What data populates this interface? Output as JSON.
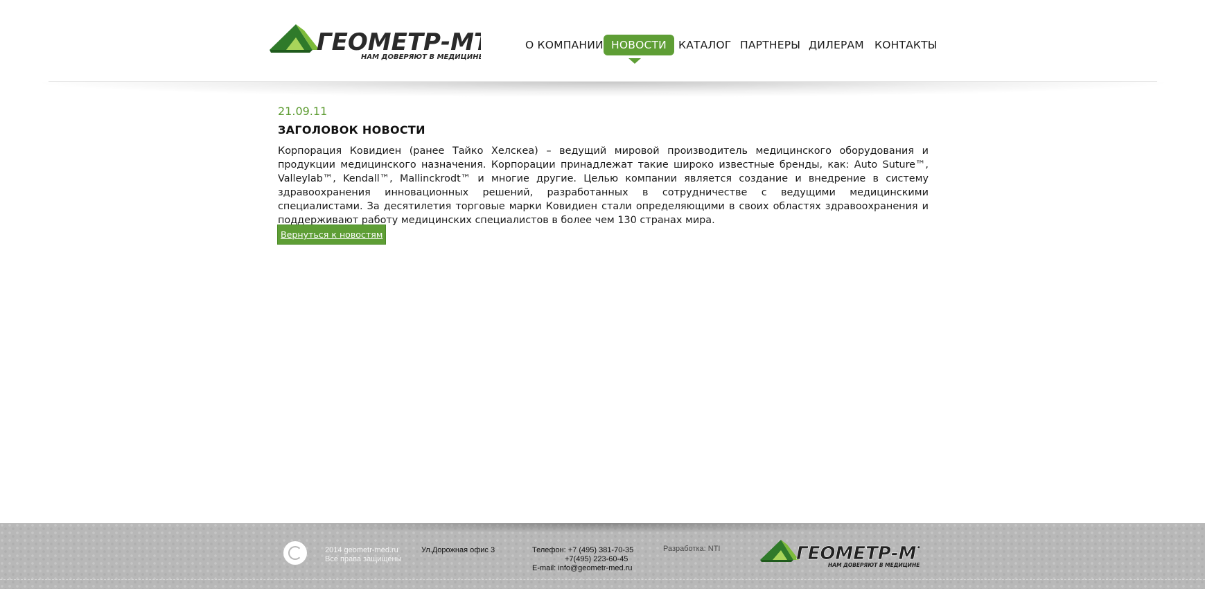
{
  "header": {
    "logo": {
      "name": "ГЕОМЕТР-МТ",
      "tagline": "НАМ ДОВЕРЯЮТ В МЕДИЦИНЕ"
    },
    "nav": [
      {
        "label": "О КОМПАНИИ",
        "active": false
      },
      {
        "label": "НОВОСТИ",
        "active": true
      },
      {
        "label": "КАТАЛОГ",
        "active": false
      },
      {
        "label": "ПАРТНЕРЫ",
        "active": false
      },
      {
        "label": "ДИЛЕРАМ",
        "active": false
      },
      {
        "label": "КОНТАКТЫ",
        "active": false
      }
    ]
  },
  "article": {
    "date": "21.09.11",
    "title": "ЗАГОЛОВОК НОВОСТИ",
    "body": "Корпорация Ковидиен (ранее Тайко Хелскеа) – ведущий мировой производитель медицинского оборудования и продукции медицинского назначения. Корпорации принадлежат такие широко известные бренды, как: Auto Suture™, Valleylab™, Kendall™, Mallinckrodt™ и многие другие. Целью компании является создание и внедрение в систему здравоохранения инновационных решений, разработанных в сотрудничестве с ведущими медицинскими специалистами. За десятилетия торговые марки Ковидиен стали определяющими в своих областях здравоохранения и поддерживают работу медицинских специалистов в более чем 130 странах мира.",
    "back_link": "Вернуться к новостям"
  },
  "footer": {
    "copyright_line1": "2014 geometr-med.ru",
    "copyright_line2": "Все права защищены",
    "address": "Ул.Дорожная  офис 3",
    "phone_line1": "Телефон: +7 (495) 381-70-35",
    "phone_line2": "+7(495) 223-60-45",
    "email_line": "E-mail: info@geometr-med.ru",
    "developer": "Разработка: NTI",
    "logo": {
      "name": "ГЕОМЕТР-МТ",
      "tagline": "НАМ ДОВЕРЯЮТ В МЕДИЦИНЕ"
    }
  },
  "colors": {
    "accent_green": "#5e9e35",
    "date_green": "#5a9a2e",
    "footer_gray": "#b8b8b8"
  },
  "icons": [
    "logo-mountain-icon",
    "copyright-icon",
    "nav-active-arrow-icon"
  ]
}
